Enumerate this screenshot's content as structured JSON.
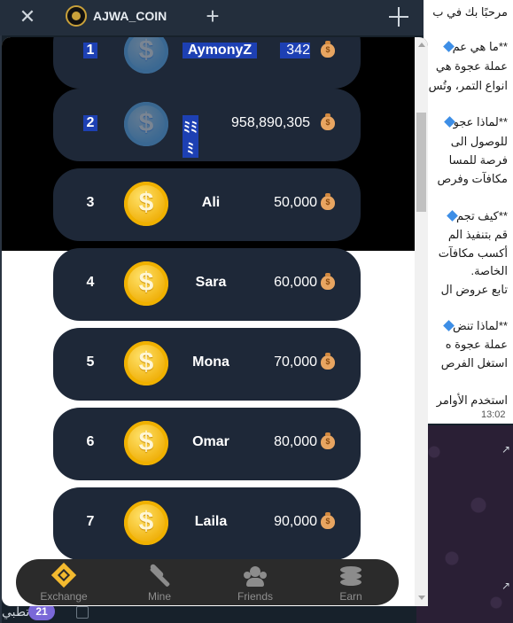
{
  "window": {
    "title": "AJWA_COIN",
    "close_glyph": "✕",
    "plus_glyph": "+"
  },
  "leaderboard": [
    {
      "rank": "1",
      "name": "AymonyZ",
      "score": "342"
    },
    {
      "rank": "2",
      "name": "ﾐﾐﾐ",
      "score": "958,890,305"
    },
    {
      "rank": "3",
      "name": "Ali",
      "score": "50,000"
    },
    {
      "rank": "4",
      "name": "Sara",
      "score": "60,000"
    },
    {
      "rank": "5",
      "name": "Mona",
      "score": "70,000"
    },
    {
      "rank": "6",
      "name": "Omar",
      "score": "80,000"
    },
    {
      "rank": "7",
      "name": "Laila",
      "score": "90,000"
    }
  ],
  "nav": [
    {
      "label": "Exchange",
      "icon": "binance-icon"
    },
    {
      "label": "Mine",
      "icon": "pickaxe-icon"
    },
    {
      "label": "Friends",
      "icon": "friends-icon"
    },
    {
      "label": "Earn",
      "icon": "coins-stack-icon"
    }
  ],
  "chat": {
    "lines": [
      "مرحبًا بك في ب",
      "**ما هي عم",
      "عملة عجوة هي",
      "انواع التمر، وتُس",
      "**لماذا عجو",
      "للوصول الى",
      "فرصة للمسا",
      "مكافآت وفرص",
      "**كيف تجم",
      "قم بتنفيذ الم",
      "أكسب مكافآت",
      "الخاصة.",
      "تابع عروض ال",
      "**لماذا تنض",
      "عملة عجوة ه",
      "استغل الفرص",
      "استخدم الأوامر"
    ],
    "time": "13:02",
    "unread_count": "21",
    "bottom_text": "تطبي"
  },
  "colors": {
    "card_bg": "#1e2838",
    "coin_gold": "#f2b614",
    "nav_bg": "#2b2b2b",
    "accent": "#f3ba2f"
  }
}
